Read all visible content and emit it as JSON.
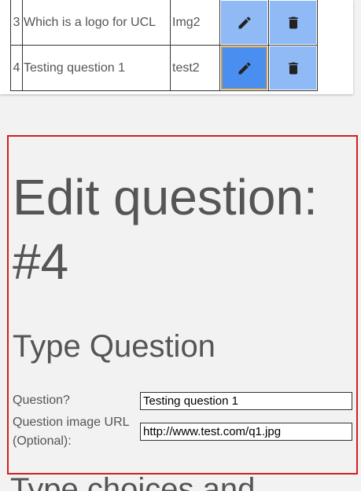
{
  "questions_table": {
    "rows": [
      {
        "num": "3",
        "question": "Which is a logo for UCL",
        "image": "Img2",
        "edit_active": false
      },
      {
        "num": "4",
        "question": "Testing question 1",
        "image": "test2",
        "edit_active": true
      }
    ],
    "edit_icon": "pencil-icon",
    "delete_icon": "trash-icon"
  },
  "edit_panel": {
    "title": "Edit question: #4",
    "section_heading": "Type Question",
    "question_label": "Question?",
    "question_value": "Testing question 1",
    "image_url_label": "Question image URL (Optional):",
    "image_url_value": "http://www.test.com/q1.jpg"
  },
  "next_section_heading": "Type choices and",
  "colors": {
    "button_light": "#8fbaf5",
    "button_active": "#4a8ff0",
    "panel_border": "#d21f1f",
    "text": "#555555"
  }
}
